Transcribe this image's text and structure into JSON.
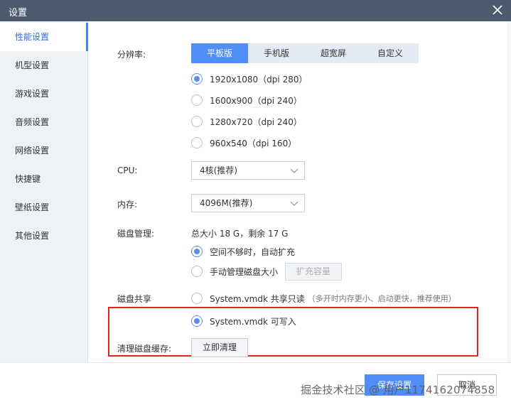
{
  "window": {
    "title": "设置"
  },
  "sidebar": {
    "items": [
      {
        "label": "性能设置",
        "active": true
      },
      {
        "label": "机型设置"
      },
      {
        "label": "游戏设置"
      },
      {
        "label": "音频设置"
      },
      {
        "label": "网络设置"
      },
      {
        "label": "快捷键"
      },
      {
        "label": "壁纸设置"
      },
      {
        "label": "其他设置"
      }
    ]
  },
  "resolution": {
    "label": "分辨率:",
    "tabs": [
      {
        "label": "平板版",
        "active": true
      },
      {
        "label": "手机版"
      },
      {
        "label": "超宽屏"
      },
      {
        "label": "自定义"
      }
    ],
    "options": [
      {
        "label": "1920x1080（dpi 280）",
        "selected": true
      },
      {
        "label": "1600x900（dpi 240）"
      },
      {
        "label": "1280x720（dpi 240）"
      },
      {
        "label": "960x540（dpi 160）"
      }
    ]
  },
  "cpu": {
    "label": "CPU:",
    "value": "4核(推荐)"
  },
  "memory": {
    "label": "内存:",
    "value": "4096M(推荐)"
  },
  "disk": {
    "label": "磁盘管理:",
    "summary": "总大小 18 G，剩余 17 G",
    "options": [
      {
        "label": "空间不够时，自动扩充",
        "selected": true
      },
      {
        "label": "手动管理磁盘大小"
      }
    ],
    "expand_button": "扩充容量"
  },
  "disk_share": {
    "label": "磁盘共享",
    "options": [
      {
        "label": "System.vmdk 共享只读",
        "sub": "（多开时内存更小、启动更快，推荐使用）"
      },
      {
        "label": "System.vmdk 可写入",
        "selected": true
      }
    ]
  },
  "cache": {
    "label": "清理磁盘缓存:",
    "button": "立即清理"
  },
  "footer": {
    "save": "保存设置",
    "cancel": "取消"
  },
  "watermark": "掘金技术社区 @ 用户1174162074858",
  "colors": {
    "accent": "#4f8ef7",
    "titlebar": "#4c5a6e",
    "highlight": "#e02424"
  },
  "icons": {
    "close": "close-icon",
    "dropdown": "chevron-down-icon"
  }
}
